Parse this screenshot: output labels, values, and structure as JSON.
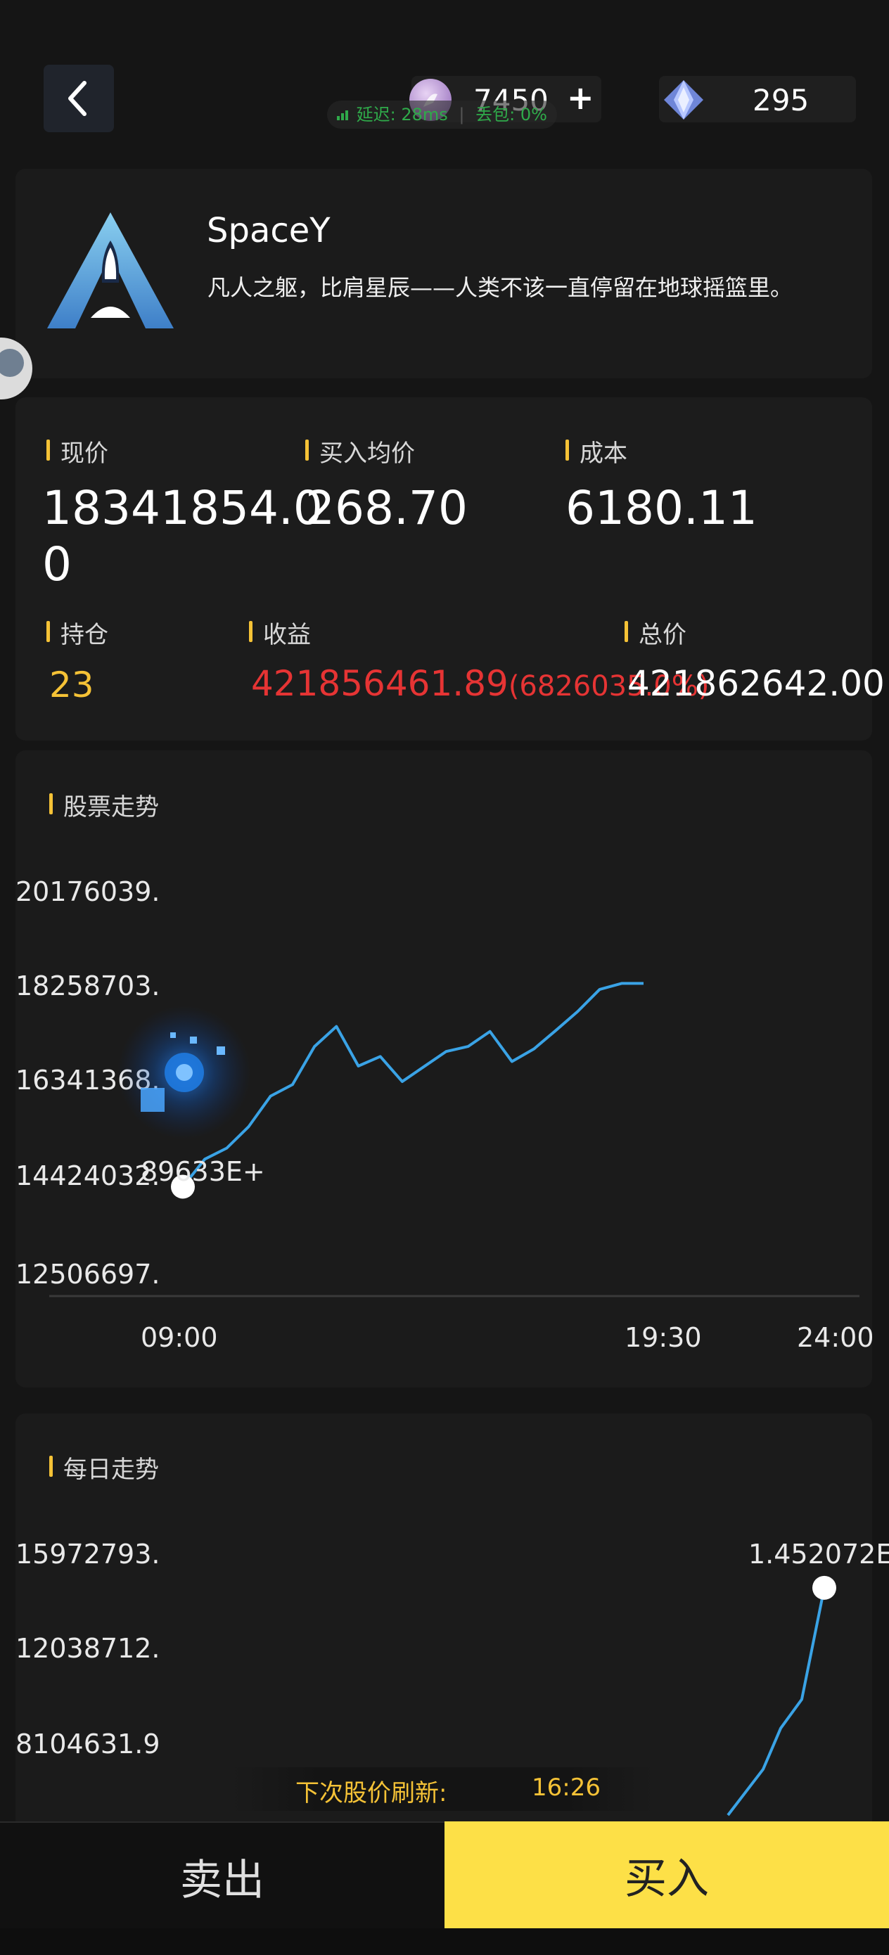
{
  "header": {
    "coin_value": "7450",
    "coin_add": "+",
    "gem_value": "295",
    "latency_label": "延迟: 28ms",
    "loss_label": "丢包: 0%"
  },
  "company": {
    "name": "SpaceY",
    "slogan": "凡人之躯，比肩星辰——人类不该一直停留在地球摇篮里。"
  },
  "stats": {
    "price_label": "现价",
    "price_value": "18341854.00",
    "avg_label": "买入均价",
    "avg_value": "268.70",
    "cost_label": "成本",
    "cost_value": "6180.11",
    "hold_label": "持仓",
    "hold_value": "23",
    "profit_label": "收益",
    "profit_value": "421856461.89",
    "profit_pct": "(6826035.0%)",
    "total_label": "总价",
    "total_value": "421862642.00"
  },
  "trend_card": {
    "title": "股票走势",
    "y_ticks": [
      "20176039.",
      "18258703.",
      "16341368.",
      "14424032.",
      "12506697."
    ],
    "x_ticks": [
      "09:00",
      "19:30",
      "24:00"
    ],
    "start_label": "89633E+"
  },
  "daily_card": {
    "title": "每日走势",
    "y_ticks": [
      "15972793.",
      "12038712.",
      "8104631.9"
    ],
    "end_label": "1.452072E"
  },
  "refresh": {
    "label": "下次股价刷新:",
    "time": "16:26"
  },
  "actions": {
    "sell": "卖出",
    "buy": "买入"
  },
  "colors": {
    "accent": "#f5c236",
    "loss": "#e63434",
    "line": "#3aa3e6",
    "buy_bg": "#fde047"
  },
  "chart_data": [
    {
      "type": "line",
      "title": "股票走势",
      "ylim": [
        12506697,
        20176039
      ],
      "x_ticks": [
        "09:00",
        "19:30",
        "24:00"
      ],
      "x": [
        0,
        0.5,
        1,
        1.5,
        2,
        2.5,
        3,
        3.5,
        4,
        4.5,
        5,
        5.5,
        6,
        6.5,
        7,
        7.5,
        8,
        8.5,
        9,
        9.5,
        10,
        10.5
      ],
      "values": [
        14200000,
        14750000,
        14970000,
        15400000,
        16010000,
        16240000,
        17000000,
        17400000,
        16610000,
        16800000,
        16300000,
        16600000,
        16900000,
        17000000,
        17300000,
        16700000,
        16950000,
        17320000,
        17700000,
        18140000,
        18260000,
        18260000
      ]
    },
    {
      "type": "line",
      "title": "每日走势",
      "y_ticks": [
        15972793,
        12038712,
        8104631.9
      ],
      "values": [
        5100000,
        7000000,
        8700000,
        9900000,
        14520720
      ]
    }
  ]
}
